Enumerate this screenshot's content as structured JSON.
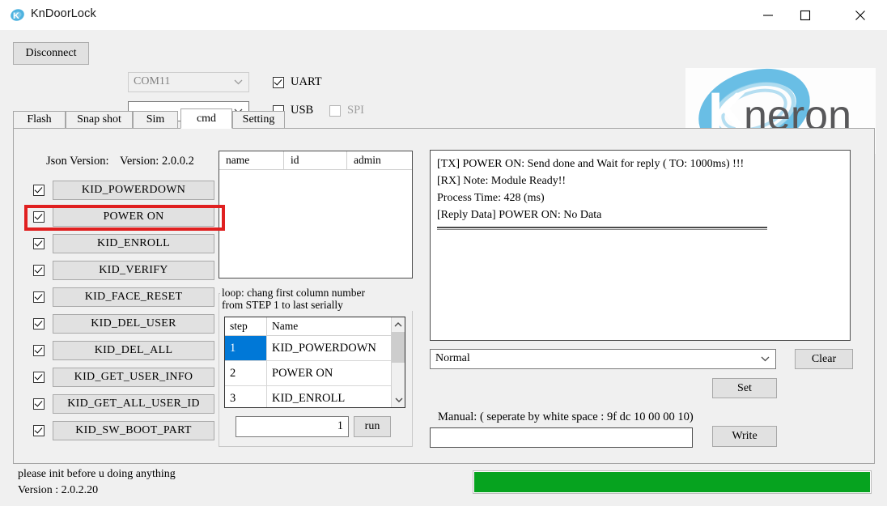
{
  "window": {
    "title": "KnDoorLock",
    "app_icon": "kn-logo-icon",
    "minimize": "minimize-icon",
    "maximize": "maximize-icon",
    "close": "close-icon"
  },
  "connection": {
    "disconnect_label": "Disconnect",
    "com_port": "COM11",
    "baud_value": "",
    "checkboxes": [
      {
        "label": "UART",
        "checked": true,
        "disabled": false
      },
      {
        "label": "USB",
        "checked": false,
        "disabled": false
      },
      {
        "label": "SPI",
        "checked": false,
        "disabled": true
      }
    ]
  },
  "logo": {
    "k_letter": "K",
    "word": "neron",
    "brand_blue": "#3aaee0",
    "brand_gray": "#58585a"
  },
  "tabs": [
    {
      "label": "Flash",
      "active": false
    },
    {
      "label": "Snap shot",
      "active": false
    },
    {
      "label": "Sim",
      "active": false
    },
    {
      "label": "cmd",
      "active": true
    },
    {
      "label": "Setting",
      "active": false
    }
  ],
  "cmd_panel": {
    "json_version_label": "Json Version:",
    "json_version_value": "Version: 2.0.0.2",
    "commands": [
      {
        "label": "KID_POWERDOWN",
        "checked": true
      },
      {
        "label": "POWER ON",
        "checked": true
      },
      {
        "label": "KID_ENROLL",
        "checked": true
      },
      {
        "label": "KID_VERIFY",
        "checked": true
      },
      {
        "label": "KID_FACE_RESET",
        "checked": true
      },
      {
        "label": "KID_DEL_USER",
        "checked": true
      },
      {
        "label": "KID_DEL_ALL",
        "checked": true
      },
      {
        "label": "KID_GET_USER_INFO",
        "checked": true
      },
      {
        "label": "KID_GET_ALL_USER_ID",
        "checked": true
      },
      {
        "label": "KID_SW_BOOT_PART",
        "checked": true
      }
    ],
    "highlight": {
      "target": "POWER ON",
      "color": "#e02020"
    }
  },
  "user_table": {
    "columns": [
      "name",
      "id",
      "admin"
    ],
    "rows": []
  },
  "loop_group": {
    "legend_line1": "loop: chang first column number",
    "legend_line2": "from STEP 1 to last serially",
    "columns": [
      "step",
      "Name"
    ],
    "rows": [
      {
        "step": "1",
        "name": "KID_POWERDOWN",
        "selected": true
      },
      {
        "step": "2",
        "name": "POWER ON",
        "selected": false
      },
      {
        "step": "3",
        "name": "KID_ENROLL",
        "selected": false
      }
    ],
    "count_value": "1",
    "run_label": "run",
    "scroll_up_icon": "chevron-up-icon",
    "scroll_down_icon": "chevron-down-icon"
  },
  "log": {
    "lines": [
      "[TX] POWER ON: Send done and Wait for reply ( TO: 1000ms) !!!",
      "[RX] Note: Module Ready!!",
      "Process Time: 428 (ms)",
      "[Reply Data] POWER ON: No Data"
    ]
  },
  "controls": {
    "mode_value": "Normal",
    "clear_label": "Clear",
    "set_label": "Set",
    "manual_label": "Manual: ( seperate by white space : 9f dc 10 00 00 10)",
    "manual_value": "",
    "write_label": "Write"
  },
  "status": {
    "line1": "please init before u doing anything",
    "line2": "Version : 2.0.2.20",
    "progress_percent": 100,
    "progress_color": "#06a31f"
  }
}
